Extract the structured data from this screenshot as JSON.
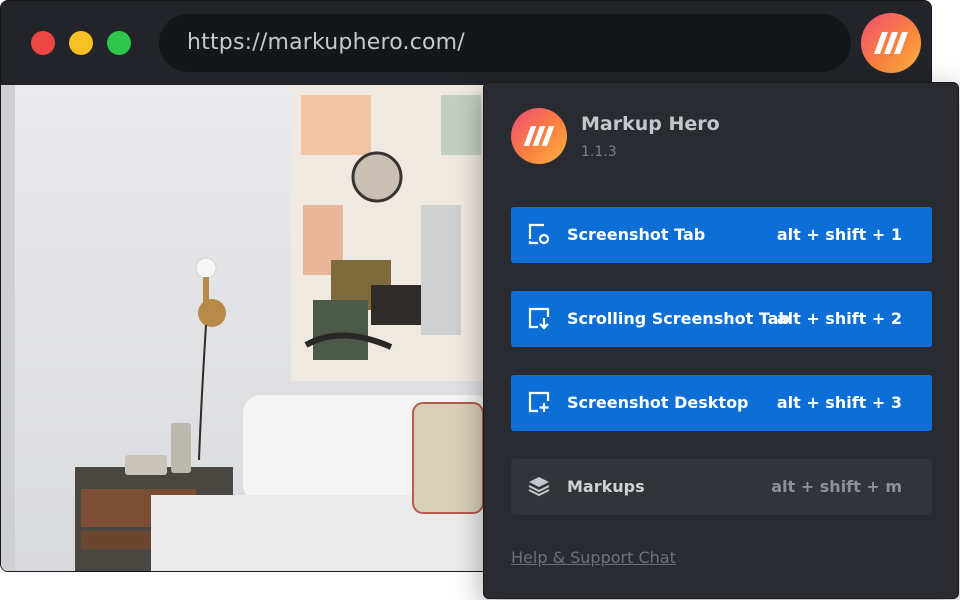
{
  "browser": {
    "url": "https://markuphero.com/",
    "window_controls": [
      "close",
      "minimize",
      "maximize"
    ],
    "extension_icon": "markup-hero-logo-icon"
  },
  "popup": {
    "app_name": "Markup Hero",
    "version": "1.1.3",
    "actions": [
      {
        "label": "Screenshot Tab",
        "shortcut": "alt + shift + 1",
        "icon": "screenshot-tab-icon"
      },
      {
        "label": "Scrolling Screenshot Tab",
        "shortcut": "alt + shift + 2",
        "icon": "scrolling-screenshot-icon"
      },
      {
        "label": "Screenshot Desktop",
        "shortcut": "alt + shift + 3",
        "icon": "screenshot-desktop-icon"
      },
      {
        "label": "Markups",
        "shortcut": "alt + shift + m",
        "icon": "layers-icon"
      }
    ],
    "help_link": "Help & Support Chat"
  },
  "colors": {
    "accent_blue": "#0d6fd6",
    "popup_bg": "#292b31",
    "browser_chrome": "#222429",
    "logo_gradient_start": "#f04c78",
    "logo_gradient_end": "#fdb542"
  }
}
